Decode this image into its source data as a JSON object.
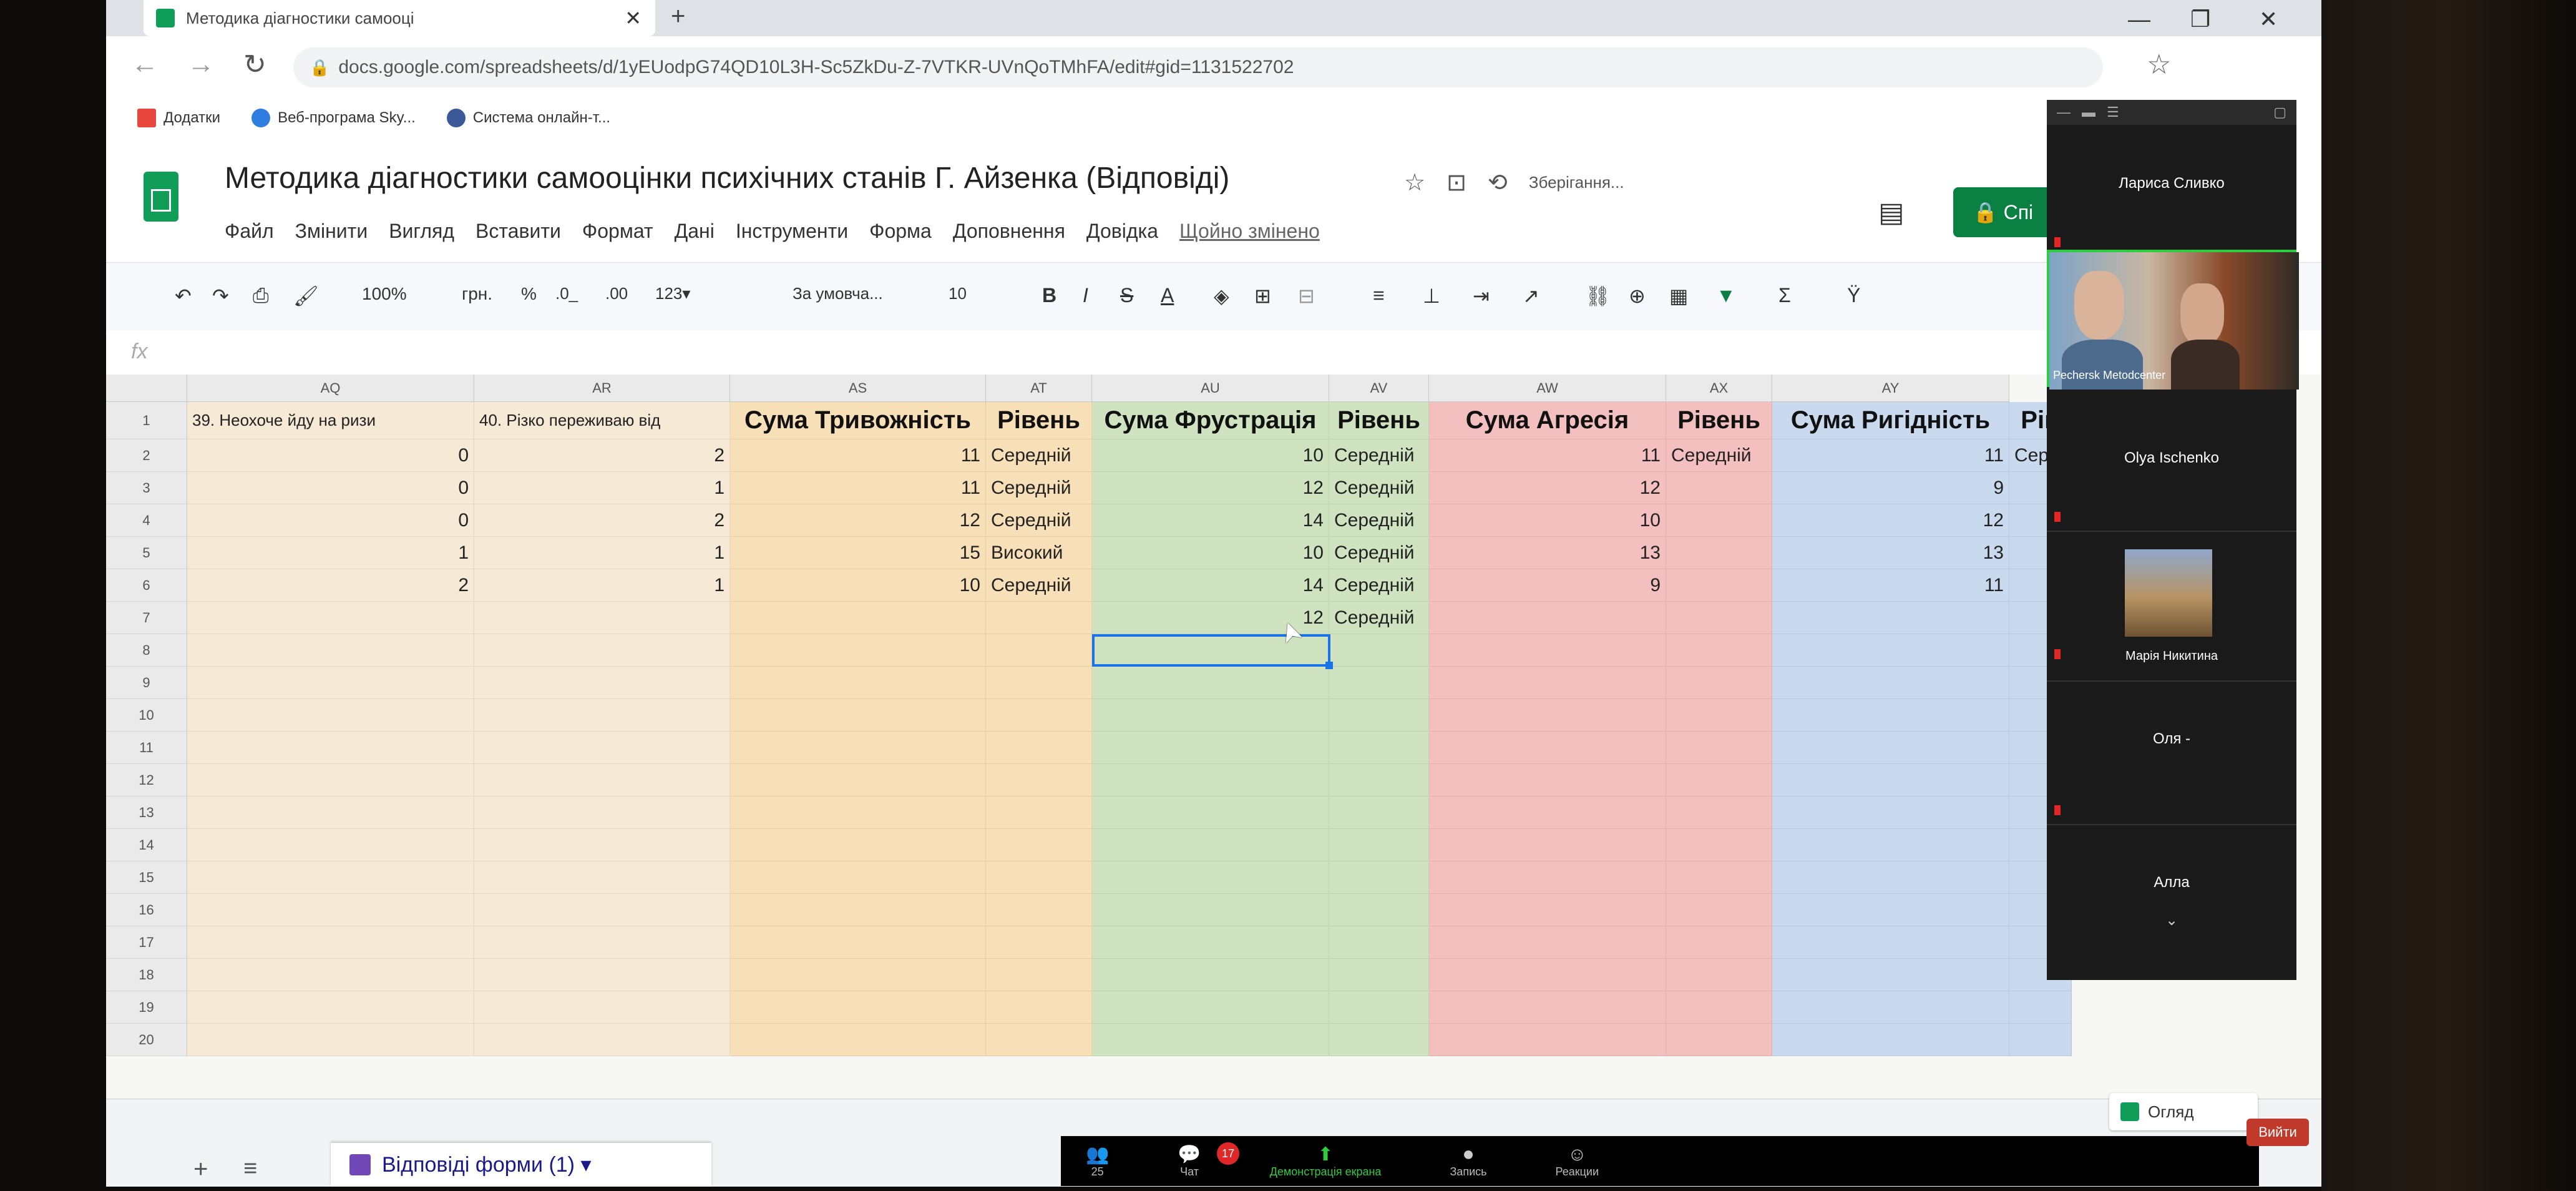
{
  "browser": {
    "tab_title": "Методика діагностики самооці",
    "url": "docs.google.com/spreadsheets/d/1yEUodpG74QD10L3H-Sc5ZkDu-Z-7VTKR-UVnQoTMhFA/edit#gid=1131522702",
    "bookmarks": [
      "Додатки",
      "Веб-програма Sky...",
      "Система онлайн-т..."
    ]
  },
  "doc": {
    "title": "Методика діагностики самооцінки психічних станів Г. Айзенка (Відповіді)",
    "saving": "Зберігання...",
    "menu": [
      "Файл",
      "Змінити",
      "Вигляд",
      "Вставити",
      "Формат",
      "Дані",
      "Інструменти",
      "Форма",
      "Доповнення",
      "Довідка"
    ],
    "last_edit": "Щойно змінено",
    "share_label": "Спі"
  },
  "toolbar": {
    "zoom": "100%",
    "currency": "грн.",
    "percent": "%",
    "dec_less": ".0_",
    ".dec_more": ".00",
    "format_more": "123▾",
    "font": "За умовча...",
    "size": "10",
    "bold": "B",
    "italic": "I",
    "strike": "S",
    "color": "A",
    "sigma": "Σ"
  },
  "formula_bar": {
    "fx": "fx"
  },
  "sheet": {
    "columns": [
      "AQ",
      "AR",
      "AS",
      "AT",
      "AU",
      "AV",
      "AW",
      "AX",
      "AY"
    ],
    "header_row": [
      "39. Неохоче йду на ризи",
      "40. Різко переживаю від",
      "Сума Тривожність",
      "Рівень",
      "Сума Фрустрація",
      "Рівень",
      "Сума Агресія",
      "Рівень",
      "Сума Ригідність",
      "Рів"
    ],
    "row_numbers": [
      "1",
      "2",
      "3",
      "4",
      "5",
      "6",
      "7",
      "8",
      "9",
      "10",
      "11",
      "12",
      "13",
      "14",
      "15",
      "16",
      "17",
      "18",
      "19",
      "20"
    ],
    "rows": [
      [
        "0",
        "2",
        "11",
        "Середній",
        "10",
        "Середній",
        "11",
        "Середній",
        "11",
        "Сере"
      ],
      [
        "0",
        "1",
        "11",
        "Середній",
        "12",
        "Середній",
        "12",
        "",
        "9",
        ""
      ],
      [
        "0",
        "2",
        "12",
        "Середній",
        "14",
        "Середній",
        "10",
        "",
        "12",
        ""
      ],
      [
        "1",
        "1",
        "15",
        "Високий",
        "10",
        "Середній",
        "13",
        "",
        "13",
        ""
      ],
      [
        "2",
        "1",
        "10",
        "Середній",
        "14",
        "Середній",
        "9",
        "",
        "11",
        ""
      ],
      [
        "",
        "",
        "",
        "",
        "12",
        "Середній",
        "",
        "",
        "",
        ""
      ]
    ],
    "tab_name": "Відповіді форми (1)",
    "explore": "Огляд"
  },
  "zoom": {
    "participants": [
      "Лариса Сливко",
      "Pechersk Metodcenter",
      "Olya Ischenko",
      "Марія Никитина",
      "Оля -",
      "Алла"
    ],
    "bar": [
      {
        "icon": "👥",
        "label": "25"
      },
      {
        "icon": "💬",
        "label": "Чат"
      },
      {
        "icon": "⬆",
        "label": "Демонстрація екрана"
      },
      {
        "icon": "⏺",
        "label": "Запись"
      },
      {
        "icon": "☺",
        "label": "Реакции"
      }
    ],
    "chat_badge": "17",
    "leave": "Вийти"
  },
  "colors": {
    "sheet_green": "#0f9d58",
    "share_green": "#0b8043",
    "selection_blue": "#1a73e8",
    "col_orange": "#f7dfb8",
    "col_green": "#cfe3c0",
    "col_red": "#f3bfbf",
    "col_blue": "#c9d9ee",
    "col_peach": "#f6ead6"
  }
}
